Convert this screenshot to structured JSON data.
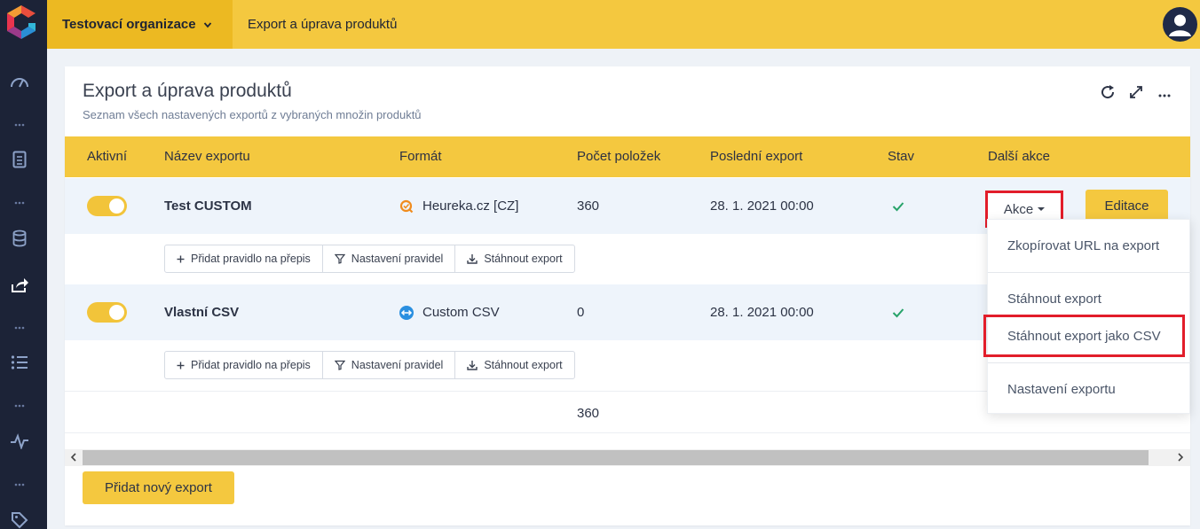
{
  "topbar": {
    "org_name": "Testovací organizace",
    "breadcrumb": "Export a úprava produktů"
  },
  "sidebar": {
    "icons": [
      "dashboard-icon",
      "document-icon",
      "database-icon",
      "share-icon",
      "list-icon",
      "pulse-icon",
      "tag-icon"
    ]
  },
  "page": {
    "title": "Export a úprava produktů",
    "subtitle": "Seznam všech nastavených exportů z vybraných množin produktů"
  },
  "table": {
    "headers": [
      "Aktivní",
      "Název exportu",
      "Formát",
      "Počet položek",
      "Poslední export",
      "Stav",
      "Další akce"
    ],
    "rows": [
      {
        "active": true,
        "name": "Test CUSTOM",
        "format": "Heureka.cz [CZ]",
        "format_icon": "heureka-icon",
        "count": "360",
        "last_export": "28. 1. 2021 00:00",
        "status": "ok"
      },
      {
        "active": true,
        "name": "Vlastní CSV",
        "format": "Custom CSV",
        "format_icon": "csv-icon",
        "count": "0",
        "last_export": "28. 1. 2021 00:00",
        "status": "ok"
      }
    ],
    "row_actions": [
      "Přidat pravidlo na přepis",
      "Nastavení pravidel",
      "Stáhnout export"
    ],
    "total": "360"
  },
  "actions": {
    "akce_label": "Akce",
    "edit_label": "Editace",
    "menu_items": [
      "Zkopírovat URL na export",
      "Stáhnout export",
      "Stáhnout export jako CSV",
      "Nastavení exportu"
    ]
  },
  "footer": {
    "add_label": "Přidat nový export"
  },
  "colors": {
    "accent": "#f4c83f",
    "sidebar": "#1c2337",
    "highlight": "#e21d2a"
  }
}
